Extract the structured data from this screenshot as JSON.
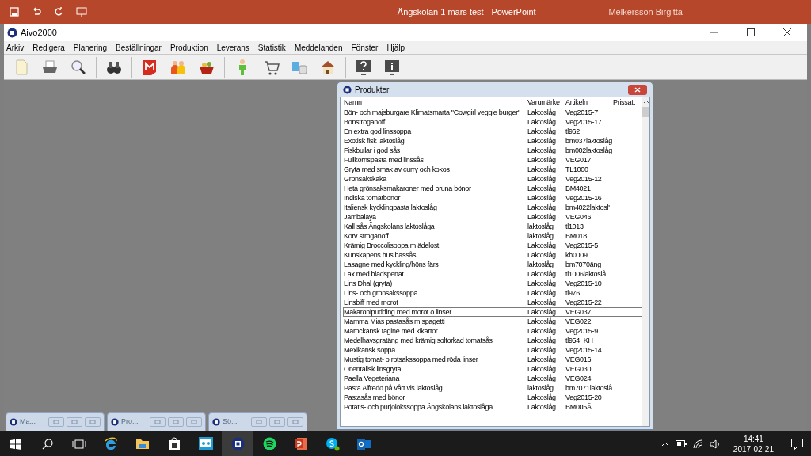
{
  "powerpoint": {
    "title": "Ängskolan 1 mars test  -  PowerPoint",
    "user": "Melkersson Birgitta"
  },
  "app": {
    "title": "Aivo2000",
    "menu": [
      "Arkiv",
      "Redigera",
      "Planering",
      "Beställningar",
      "Produktion",
      "Leverans",
      "Statistik",
      "Meddelanden",
      "Fönster",
      "Hjälp"
    ]
  },
  "products": {
    "title": "Produkter",
    "columns": [
      "Namn",
      "Varumärke",
      "Artikelnr",
      "Prissatt"
    ],
    "rows": [
      {
        "name": "Bön- och majsburgare Klimatsmarta \"Cowgirl veggie burger\"",
        "brand": "Laktoslåg",
        "article": "Veg2015-7",
        "selected": false
      },
      {
        "name": "Bönstroganoff",
        "brand": "Laktoslåg",
        "article": "Veg2015-17",
        "selected": false
      },
      {
        "name": "En extra god linssoppa",
        "brand": "Laktoslåg",
        "article": "tl962",
        "selected": false
      },
      {
        "name": "Exotisk fisk laktoslåg",
        "brand": "Laktoslåg",
        "article": "bm037laktoslåg",
        "selected": false
      },
      {
        "name": "Fiskbullar i god sås",
        "brand": "Laktoslåg",
        "article": "bm002laktoslåg",
        "selected": false
      },
      {
        "name": "Fullkornspasta med linssås",
        "brand": "Laktoslåg",
        "article": "VEG017",
        "selected": false
      },
      {
        "name": "Gryta med smak av curry och kokos",
        "brand": "Laktoslåg",
        "article": "TL1000",
        "selected": false
      },
      {
        "name": "Grönsakskaka",
        "brand": "Laktoslåg",
        "article": "Veg2015-12",
        "selected": false
      },
      {
        "name": "Heta grönsaksmakaroner med bruna bönor",
        "brand": "Laktoslåg",
        "article": "BM4021",
        "selected": false
      },
      {
        "name": "Indiska tomatbönor",
        "brand": "Laktoslåg",
        "article": "Veg2015-16",
        "selected": false
      },
      {
        "name": "Italiensk kycklingpasta laktoslåg",
        "brand": "Laktoslåg",
        "article": "bm4022laktosl'",
        "selected": false
      },
      {
        "name": "Jambalaya",
        "brand": "Laktoslåg",
        "article": "VEG046",
        "selected": false
      },
      {
        "name": "Kall sås Ängskolans laktoslåga",
        "brand": "laktoslåg",
        "article": "tl1013",
        "selected": false
      },
      {
        "name": "Korv stroganoff",
        "brand": "laktoslåg",
        "article": "BM018",
        "selected": false
      },
      {
        "name": "Krämig Broccolisoppa m ädelost",
        "brand": "Laktoslåg",
        "article": "Veg2015-5",
        "selected": false
      },
      {
        "name": "Kunskapens hus bassås",
        "brand": "Laktoslåg",
        "article": "kh0009",
        "selected": false
      },
      {
        "name": "Lasagne med kyckling/höns färs",
        "brand": "laktoslåg",
        "article": "bm7070äng",
        "selected": false
      },
      {
        "name": "Lax med bladspenat",
        "brand": "Laktoslåg",
        "article": "tl1006laktoslå",
        "selected": false
      },
      {
        "name": "Lins Dhal (gryta)",
        "brand": "Laktoslåg",
        "article": "Veg2015-10",
        "selected": false
      },
      {
        "name": "Lins- och grönsakssoppa",
        "brand": "Laktoslåg",
        "article": "tl976",
        "selected": false
      },
      {
        "name": "Linsbiff med morot",
        "brand": "Laktoslåg",
        "article": "Veg2015-22",
        "selected": false
      },
      {
        "name": "Makaronipudding med morot o linser",
        "brand": "Laktoslåg",
        "article": "VEG037",
        "selected": true
      },
      {
        "name": "Mamma Mias pastasås m spagetti",
        "brand": "Laktoslåg",
        "article": "VEG022",
        "selected": false
      },
      {
        "name": "Marockansk tagine med kikärtor",
        "brand": "Laktoslåg",
        "article": "Veg2015-9",
        "selected": false
      },
      {
        "name": "Medelhavsgratäng med krämig soltorkad tomatsås",
        "brand": "Laktoslåg",
        "article": "tl954_KH",
        "selected": false
      },
      {
        "name": "Mexikansk soppa",
        "brand": "Laktoslåg",
        "article": "Veg2015-14",
        "selected": false
      },
      {
        "name": "Mustig tomat- o rotsakssoppa med röda linser",
        "brand": "Laktoslåg",
        "article": "VEG016",
        "selected": false
      },
      {
        "name": "Orientalisk linsgryta",
        "brand": "Laktoslåg",
        "article": "VEG030",
        "selected": false
      },
      {
        "name": "Paella Vegeteriana",
        "brand": "Laktoslåg",
        "article": "VEG024",
        "selected": false
      },
      {
        "name": "Pasta Alfredo på vårt vis laktoslåg",
        "brand": "laktoslåg",
        "article": "bm7071laktoslå",
        "selected": false
      },
      {
        "name": "Pastasås med bönor",
        "brand": "Laktoslåg",
        "article": "Veg2015-20",
        "selected": false
      },
      {
        "name": "Potatis- och purjolökssoppa Ängskolans laktoslåga",
        "brand": "Laktoslåg",
        "article": "BM005Ä",
        "selected": false
      }
    ]
  },
  "minimized": [
    {
      "title": "Ma..."
    },
    {
      "title": "Pro..."
    },
    {
      "title": "Sö..."
    }
  ],
  "clock": {
    "time": "14:41",
    "date": "2017-02-21"
  }
}
